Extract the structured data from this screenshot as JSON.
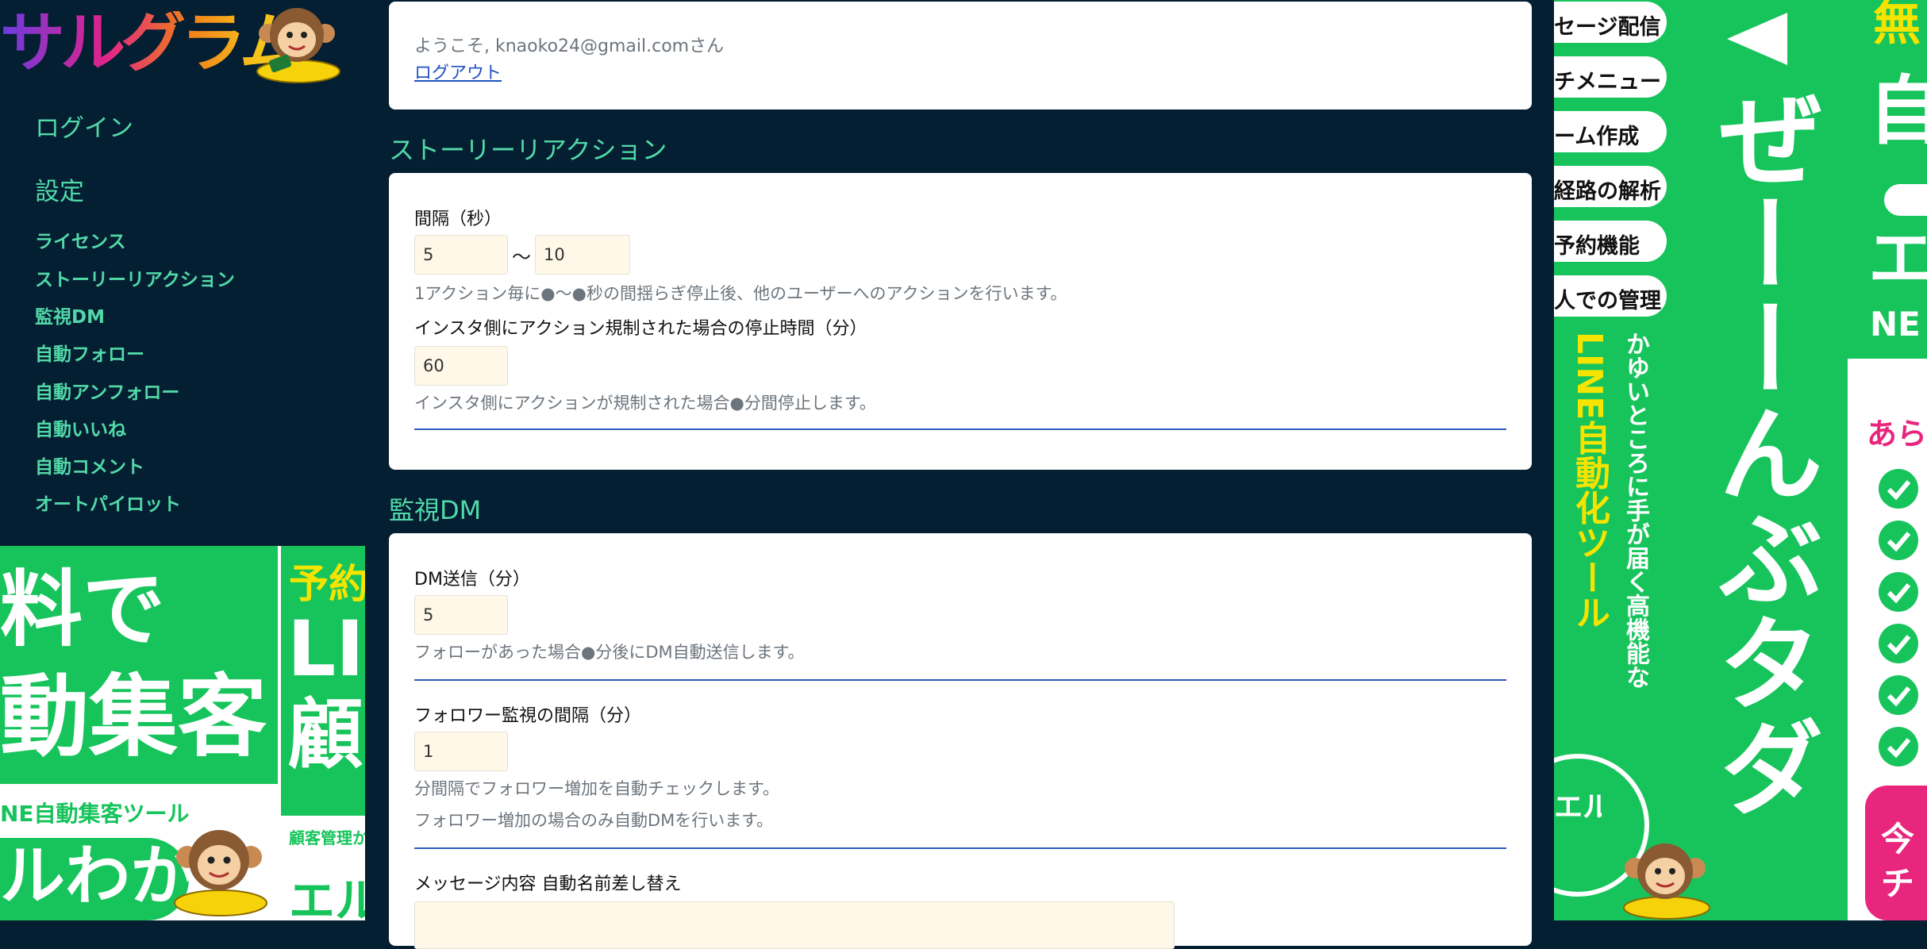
{
  "brand": {
    "logo_text": "サルグラム"
  },
  "sidebar": {
    "login": "ログイン",
    "settings": "設定",
    "items": [
      {
        "label": "ライセンス"
      },
      {
        "label": "ストーリーリアクション"
      },
      {
        "label": "監視DM"
      },
      {
        "label": "自動フォロー"
      },
      {
        "label": "自動アンフォロー"
      },
      {
        "label": "自動いいね"
      },
      {
        "label": "自動コメント"
      },
      {
        "label": "オートパイロット"
      }
    ]
  },
  "ad_left": {
    "big_line1": "料で",
    "big_line2": "動集客",
    "green_band": "NE自動集客ツール",
    "brand": "ルわか",
    "right_yellow": "予約",
    "right_big1": "LI",
    "right_big2": "顧",
    "right_small": "顧客管理か",
    "right_brand": "エル"
  },
  "welcome": {
    "text": "ようこそ, knaoko24@gmail.comさん",
    "logout": "ログアウト"
  },
  "story": {
    "title": "ストーリーリアクション",
    "interval_label": "間隔（秒）",
    "interval_min": "5",
    "tilde": "〜",
    "interval_max": "10",
    "interval_help": "1アクション毎に●〜●秒の間揺らぎ停止後、他のユーザーへのアクションを行います。",
    "stop_label": "インスタ側にアクション規制された場合の停止時間（分）",
    "stop_value": "60",
    "stop_help": "インスタ側にアクションが規制された場合●分間停止します。"
  },
  "dm": {
    "title": "監視DM",
    "send_label": "DM送信（分）",
    "send_value": "5",
    "send_help": "フォローがあった場合●分後にDM自動送信します。",
    "monitor_label": "フォロワー監視の間隔（分）",
    "monitor_value": "1",
    "monitor_help1": "分間隔でフォロワー増加を自動チェックします。",
    "monitor_help2": "フォロワー増加の場合のみ自動DMを行います。",
    "message_label": "メッセージ内容 自動名前差し替え"
  },
  "ad_right": {
    "pills": [
      "セージ配信",
      "チメニュー",
      "ーム作成",
      "経路の解析",
      "予約機能",
      "人での管理"
    ],
    "vertical_main": "ぜーーんぶタダ",
    "vertical_yellow": "LINE自動化ツール",
    "vertical_white": "かゆいところに手が届く高機能な",
    "brand": "エルわか",
    "right_yellow": "無",
    "right_big1": "自",
    "right_big2": "エ",
    "right_ne": "NE",
    "right_red": "あら",
    "right_btn": "今",
    "right_btn2": "チ",
    "colors": {
      "green": "#17c45c",
      "yellow": "#f5e400",
      "pink": "#e8267d"
    }
  }
}
